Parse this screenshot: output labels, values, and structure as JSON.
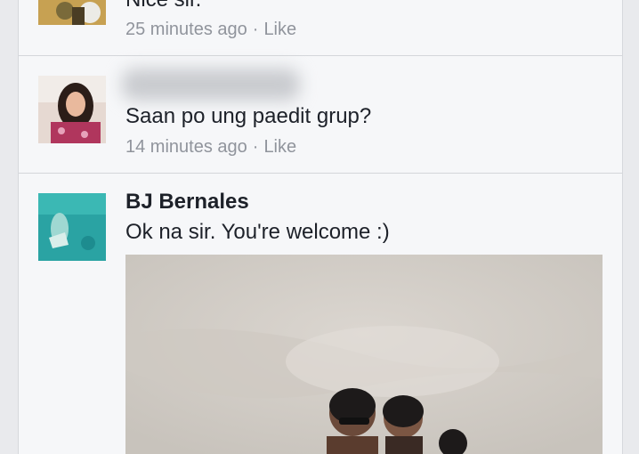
{
  "comments": [
    {
      "name": "",
      "text": "Nice sir.",
      "time": "25 minutes ago",
      "separator": "·",
      "like_label": "Like"
    },
    {
      "name": "",
      "text": "Saan po ung paedit grup?",
      "time": "14 minutes ago",
      "separator": "·",
      "like_label": "Like"
    },
    {
      "name": "BJ Bernales",
      "text": "Ok na sir. You're welcome :)"
    }
  ],
  "colors": {
    "name_text": "#1d2129",
    "meta_text": "#90949c",
    "panel_background": "#f6f7f9",
    "page_background": "#e9eaed"
  }
}
